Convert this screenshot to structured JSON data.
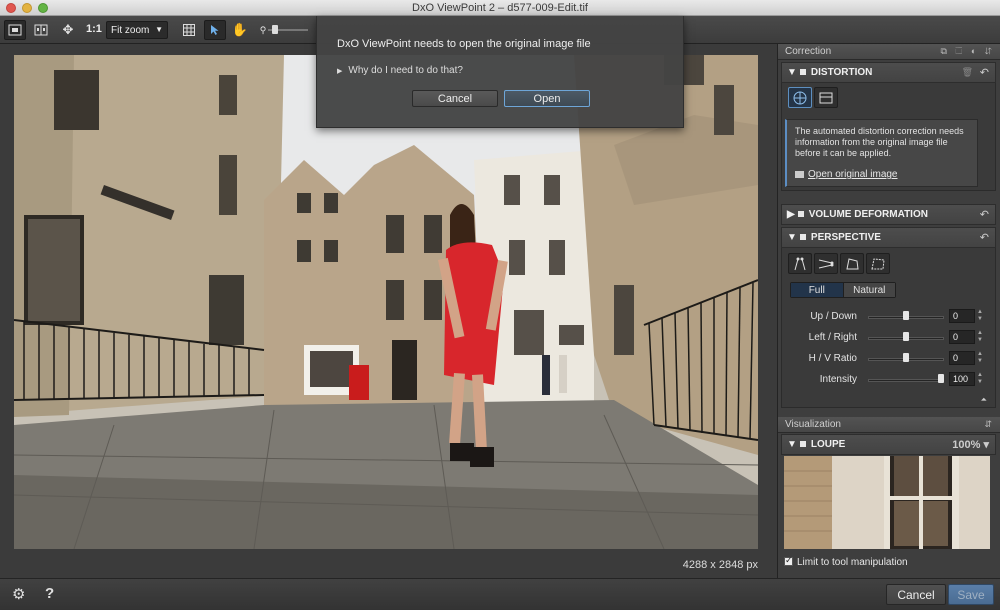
{
  "window": {
    "title": "DxO ViewPoint 2 – d577-009-Edit.tif"
  },
  "toolbar": {
    "ratio_label": "1:1",
    "zoom_value": "Fit zoom",
    "icons": [
      "display-mode-icon",
      "compare-icon",
      "move-icon",
      "grid-icon",
      "select-arrow-icon",
      "hand-icon",
      "zoom-icon"
    ]
  },
  "dialog": {
    "message": "DxO ViewPoint needs to open the original image file",
    "why_label": "Why do I need to do that?",
    "cancel_label": "Cancel",
    "open_label": "Open"
  },
  "viewer": {
    "dimensions": "4288 x 2848 px"
  },
  "panel": {
    "correction_header": "Correction",
    "distortion": {
      "title": "DISTORTION",
      "info_text": "The automated distortion correction needs information from the original image file before it can be applied.",
      "open_link": "Open original image"
    },
    "volume_deformation": {
      "title": "VOLUME DEFORMATION"
    },
    "perspective": {
      "title": "PERSPECTIVE",
      "modes": [
        "Full",
        "Natural"
      ],
      "selected_mode": "Full",
      "sliders": [
        {
          "label": "Up / Down",
          "value": "0",
          "level": 0.5
        },
        {
          "label": "Left / Right",
          "value": "0",
          "level": 0.5
        },
        {
          "label": "H / V Ratio",
          "value": "0",
          "level": 0.5
        },
        {
          "label": "Intensity",
          "value": "100",
          "level": 1.0
        }
      ]
    },
    "visualization_header": "Visualization",
    "loupe": {
      "title": "LOUPE",
      "zoom": "100%"
    },
    "limit_label": "Limit to tool manipulation"
  },
  "bottombar": {
    "cancel_label": "Cancel",
    "save_label": "Save"
  },
  "colors": {
    "accent": "#5d8fc0",
    "dress": "#d8262c",
    "panel_bg": "#3e3e3e"
  }
}
